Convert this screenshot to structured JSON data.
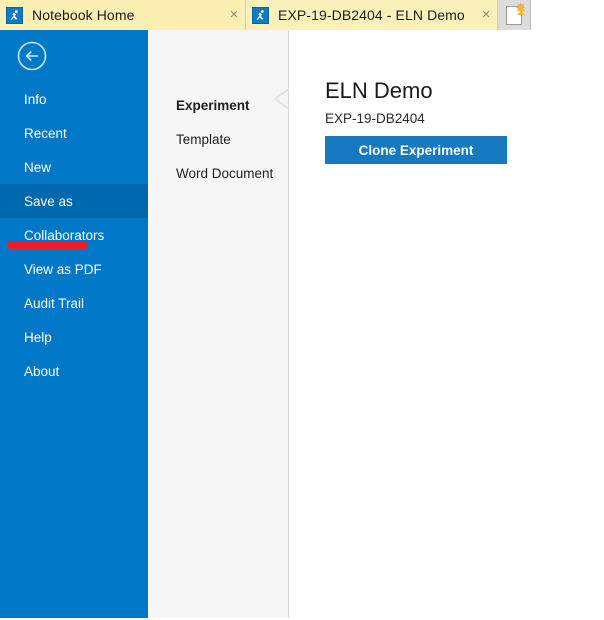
{
  "tabbar": {
    "tabs": [
      {
        "icon": "app-logo-icon",
        "label": "Notebook Home",
        "close_label": "×"
      },
      {
        "icon": "app-logo-icon",
        "label": "EXP-19-DB2404 - ELN Demo",
        "close_label": "×"
      }
    ],
    "new_tab": {
      "icon": "new-document-icon",
      "star": "✸"
    }
  },
  "sidebar": {
    "back_icon": "back-arrow-circle-icon",
    "background_color": "#0078c8",
    "selected_color": "#0068ad",
    "items": [
      {
        "label": "Info",
        "selected": false
      },
      {
        "label": "Recent",
        "selected": false
      },
      {
        "label": "New",
        "selected": false
      },
      {
        "label": "Save as",
        "selected": true
      },
      {
        "label": "Collaborators",
        "selected": false
      },
      {
        "label": "View as PDF",
        "selected": false
      },
      {
        "label": "Audit Trail",
        "selected": false
      },
      {
        "label": "Help",
        "selected": false
      },
      {
        "label": "About",
        "selected": false
      }
    ],
    "annotation": {
      "type": "red-underline-stroke",
      "color": "#ee1c25",
      "target": "Save as"
    }
  },
  "middle_panel": {
    "options": [
      {
        "label": "Experiment",
        "selected": true
      },
      {
        "label": "Template",
        "selected": false
      },
      {
        "label": "Word Document",
        "selected": false
      }
    ],
    "chevron_icon": "chevron-left-icon"
  },
  "main": {
    "title": "ELN Demo",
    "subtitle": "EXP-19-DB2404",
    "clone_button_label": "Clone Experiment",
    "accent_color": "#1678be"
  }
}
